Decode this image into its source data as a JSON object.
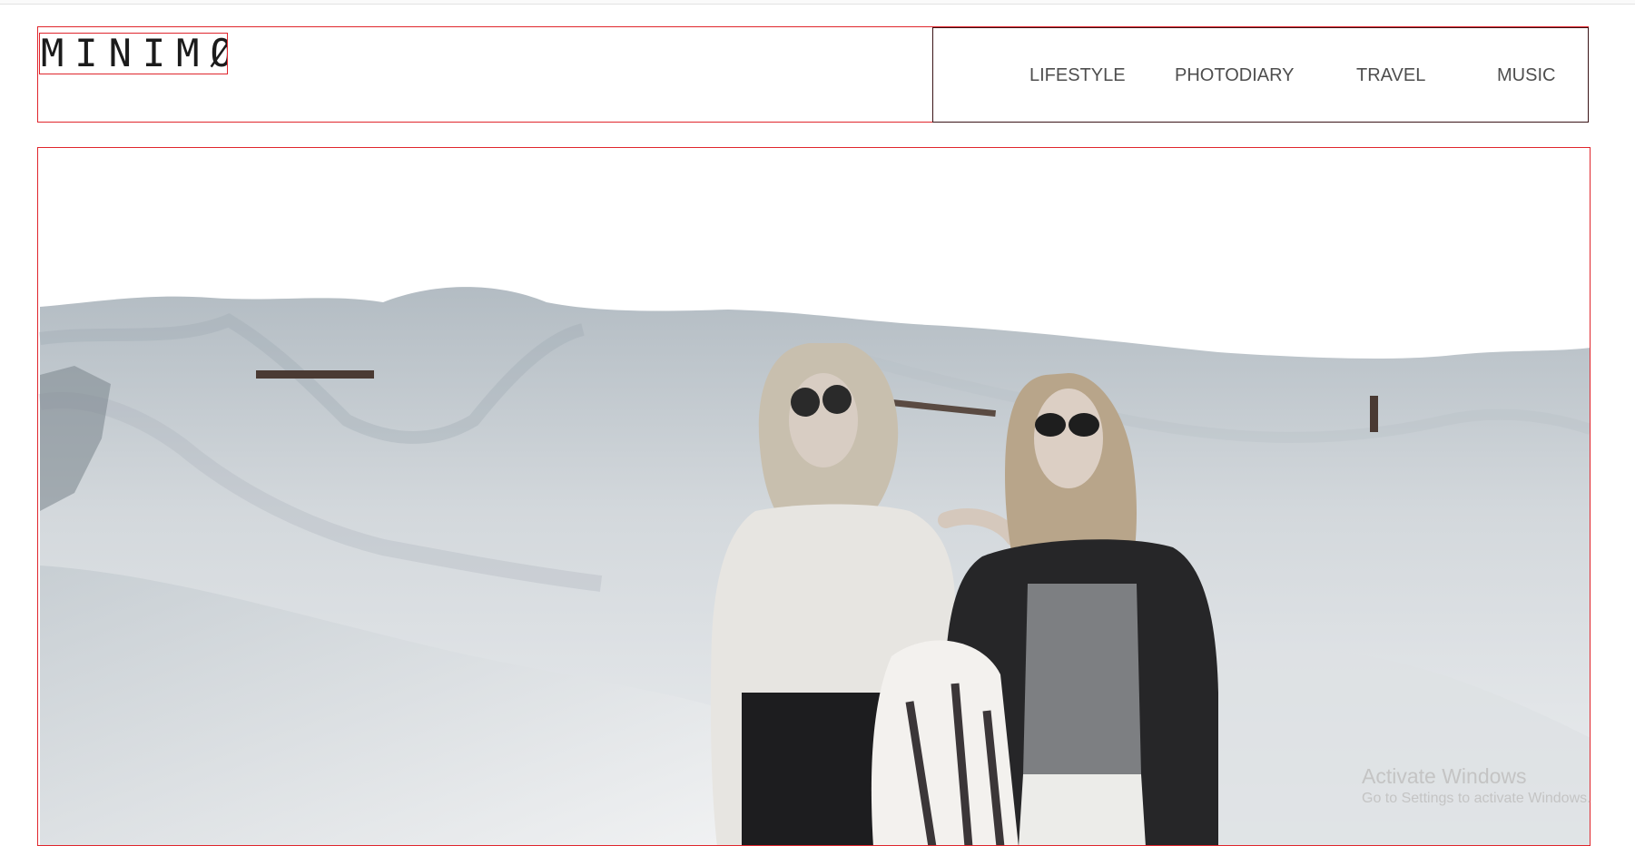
{
  "brand": {
    "logo_text": "MINIMØ"
  },
  "nav": {
    "items": [
      {
        "label": "LIFESTYLE"
      },
      {
        "label": "PHOTODIARY"
      },
      {
        "label": "TRAVEL"
      },
      {
        "label": "MUSIC"
      }
    ]
  },
  "hero": {
    "image_subject": "two-women-on-sand-dunes-photo"
  },
  "os_watermark": {
    "title": "Activate Windows",
    "subtitle": "Go to Settings to activate Windows."
  },
  "colors": {
    "outline_red": "#e0262d",
    "nav_border": "#3a1417",
    "nav_text": "#4e4e4e",
    "logo_text": "#1b1b1b"
  }
}
